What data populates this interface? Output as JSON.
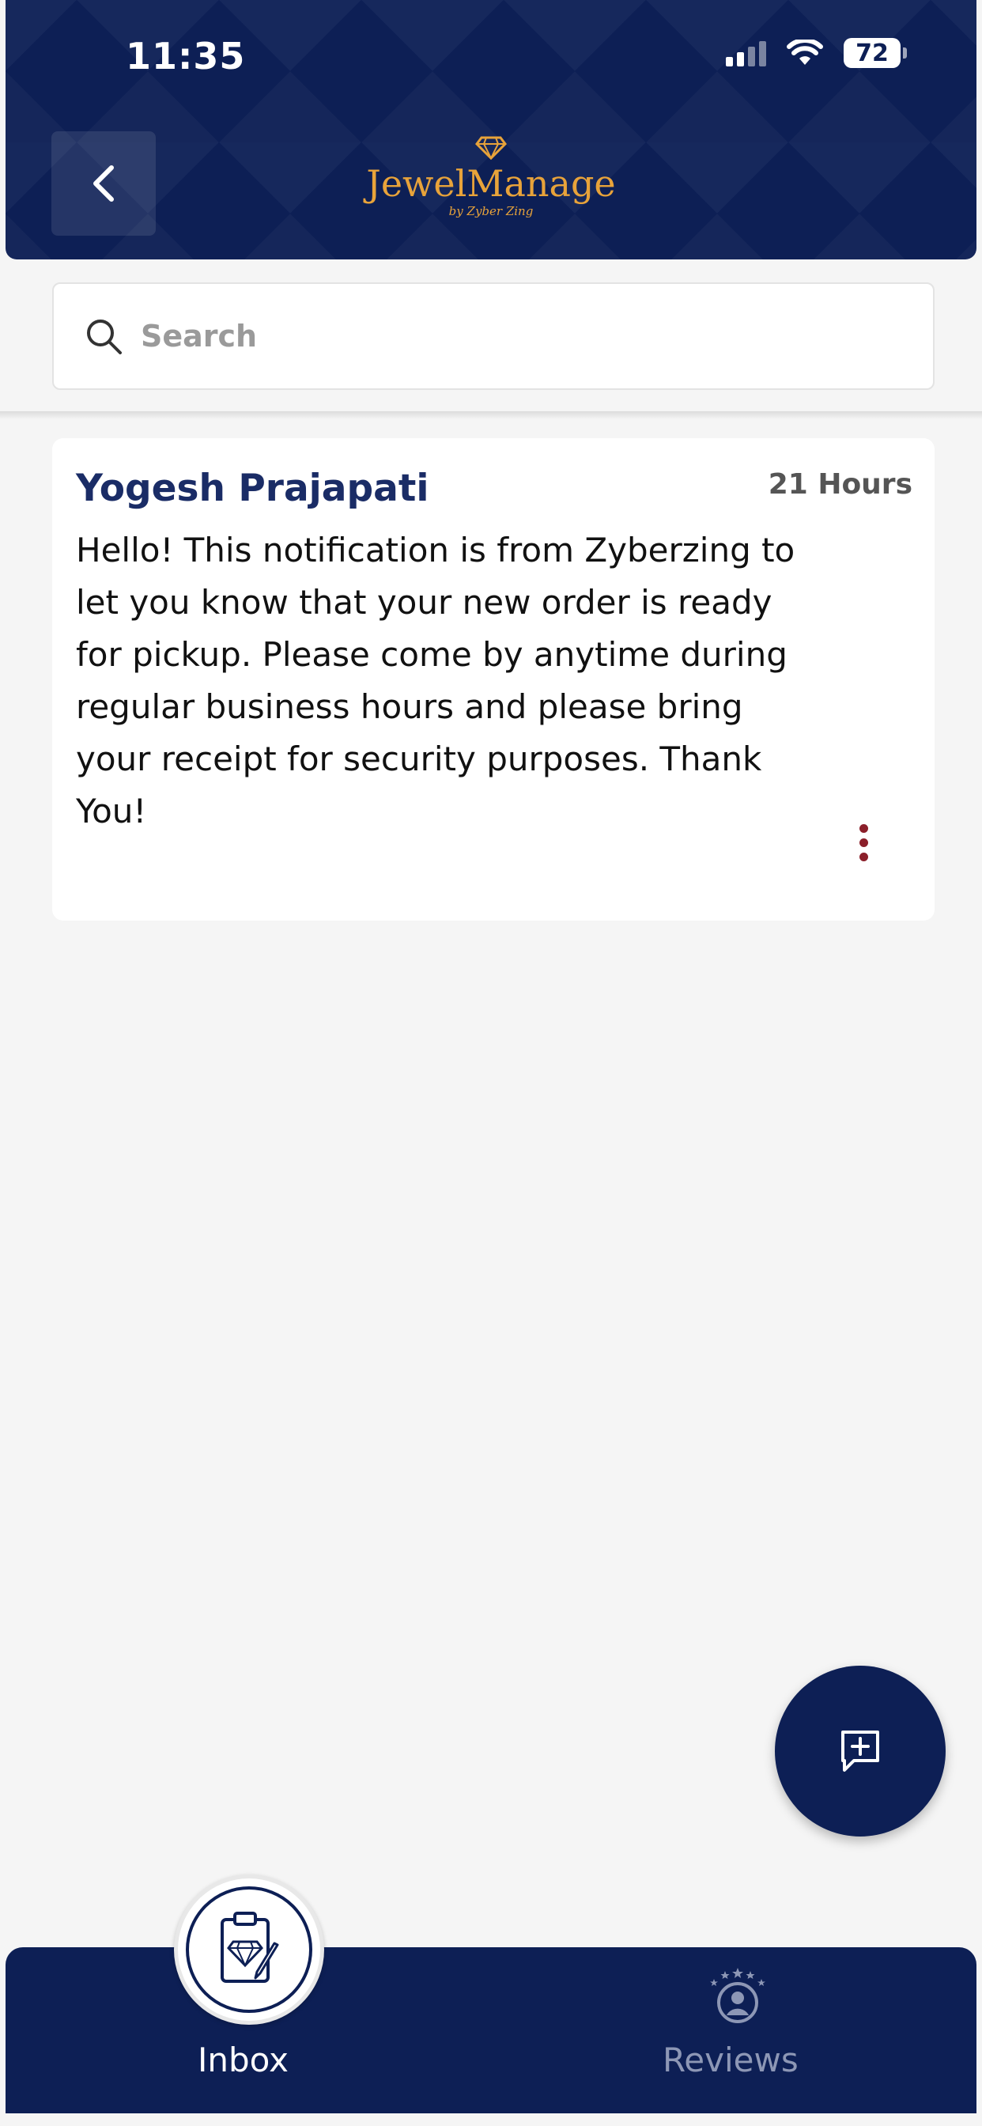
{
  "status_bar": {
    "time": "11:35",
    "battery": "72"
  },
  "header": {
    "logo_text": "JewelManage",
    "logo_sub": "by Zyber Zing",
    "back_icon": "chevron-left-icon"
  },
  "search": {
    "placeholder": "Search",
    "value": ""
  },
  "messages": [
    {
      "sender": "Yogesh Prajapati",
      "time": "21 Hours",
      "body": "Hello! This notification is from Zyberzing to let you know that your new order is ready for pickup. Please come by anytime during regular business hours and please bring your receipt for security purposes. Thank You!"
    }
  ],
  "fab": {
    "icon": "new-message-icon"
  },
  "bottom_nav": {
    "items": [
      {
        "label": "Inbox",
        "icon": "inbox-diamond-clipboard-icon",
        "active": true
      },
      {
        "label": "Reviews",
        "icon": "reviews-user-stars-icon",
        "active": false
      }
    ]
  },
  "colors": {
    "primary": "#0d1f55",
    "accent_gold": "#e8a33a",
    "name_blue": "#1a2c66",
    "menu_dots": "#8b1f2a"
  }
}
